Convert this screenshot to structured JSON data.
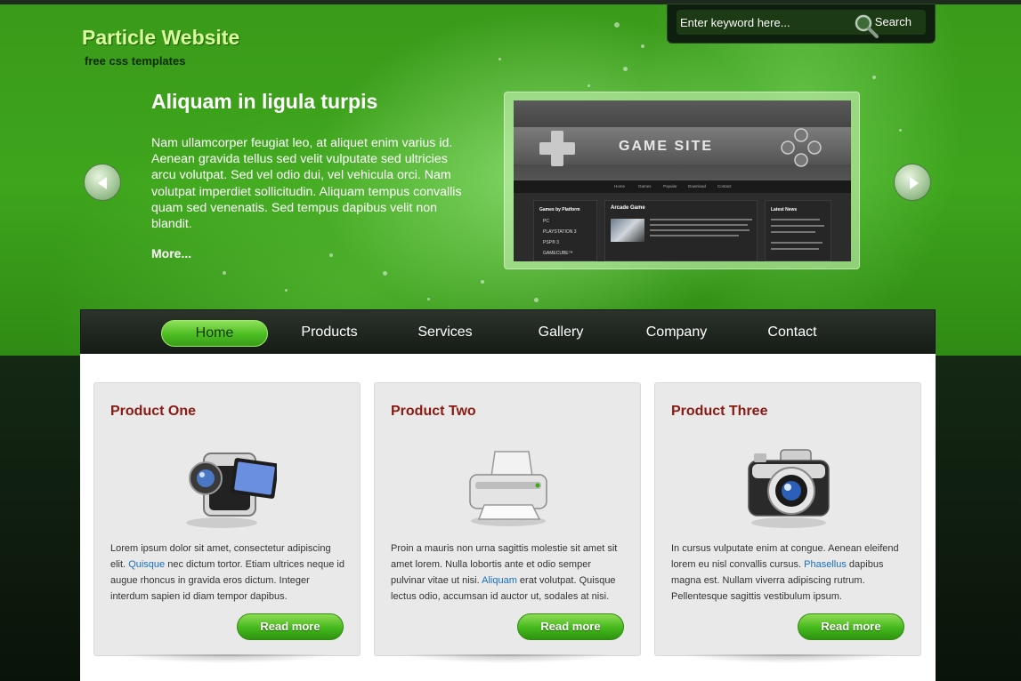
{
  "site": {
    "title": "Particle Website",
    "subtitle": "free css templates"
  },
  "search": {
    "placeholder": "Enter keyword here...",
    "button_label": "Search"
  },
  "slider": {
    "title": "Aliquam in ligula turpis",
    "body": "Nam ullamcorper feugiat leo, at aliquet enim varius id. Aenean gravida tellus sed velit vulputate sed ultricies arcu volutpat. Sed vel odio dui, vel vehicula orci. Nam volutpat imperdiet sollicitudin. Aliquam tempus convallis quam sed venenatis. Sed tempus dapibus velit non blandit.",
    "more_label": "More...",
    "preview": {
      "site_title": "GAME SITE",
      "nav": [
        "Home",
        "Games",
        "Popular",
        "Download",
        "Contact"
      ],
      "left_heading": "Games by Platform",
      "left_items": [
        "PC",
        "PLAYSTATION 3",
        "PSP® 3",
        "GAMECUBE™"
      ],
      "mid_heading": "Arcade Game",
      "right_heading": "Latest News"
    }
  },
  "nav": {
    "items": [
      {
        "label": "Home",
        "active": true
      },
      {
        "label": "Products",
        "active": false
      },
      {
        "label": "Services",
        "active": false
      },
      {
        "label": "Gallery",
        "active": false
      },
      {
        "label": "Company",
        "active": false
      },
      {
        "label": "Contact",
        "active": false
      }
    ]
  },
  "products": [
    {
      "title": "Product One",
      "icon": "camcorder-icon",
      "text_before": "Lorem ipsum dolor sit amet, consectetur adipiscing elit. ",
      "link": "Quisque",
      "text_after": " nec dictum tortor. Etiam ultrices neque id augue rhoncus in gravida eros dictum. Integer interdum sapien id diam tempor dapibus.",
      "button_label": "Read more"
    },
    {
      "title": "Product Two",
      "icon": "printer-icon",
      "text_before": "Proin a mauris non urna sagittis molestie sit amet sit amet lorem. Nulla lobortis ante et odio semper pulvinar vitae ut nisi. ",
      "link": "Aliquam",
      "text_after": " erat volutpat. Quisque lectus odio, accumsan id auctor ut, sodales at nisi.",
      "button_label": "Read more"
    },
    {
      "title": "Product Three",
      "icon": "camera-icon",
      "text_before": "In cursus vulputate enim at congue. Aenean eleifend lorem eu nisl convallis cursus. ",
      "link": "Phasellus",
      "text_after": " dapibus magna est. Nullam viverra adipiscing rutrum. Pellentesque sagittis vestibulum ipsum.",
      "button_label": "Read more"
    }
  ],
  "colors": {
    "brand_green": "#3ea51c",
    "title_green": "#d9ff9c",
    "product_title": "#8a1a12",
    "link_blue": "#1a6fc0"
  }
}
